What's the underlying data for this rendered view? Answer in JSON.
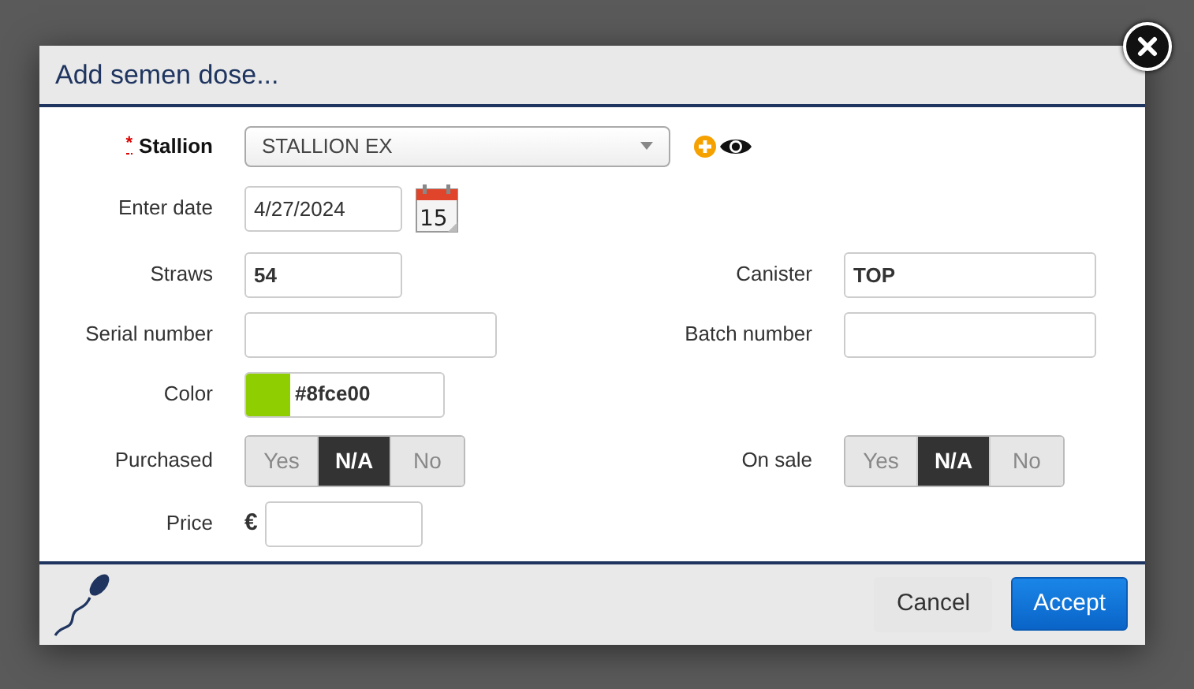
{
  "dialog": {
    "title": "Add semen dose...",
    "stallion": {
      "label": "Stallion",
      "required_mark": "*",
      "value": "STALLION EX"
    },
    "enter_date": {
      "label": "Enter date",
      "value": "4/27/2024",
      "calendar_day": "15"
    },
    "straws": {
      "label": "Straws",
      "value": "54"
    },
    "canister": {
      "label": "Canister",
      "value": "TOP"
    },
    "serial_number": {
      "label": "Serial number"
    },
    "batch_number": {
      "label": "Batch number"
    },
    "color": {
      "label": "Color",
      "value": "#8fce00"
    },
    "purchased": {
      "label": "Purchased",
      "options": [
        {
          "label": "Yes",
          "selected": false
        },
        {
          "label": "N/A",
          "selected": true
        },
        {
          "label": "No",
          "selected": false
        }
      ]
    },
    "on_sale": {
      "label": "On sale",
      "options": [
        {
          "label": "Yes",
          "selected": false
        },
        {
          "label": "N/A",
          "selected": true
        },
        {
          "label": "No",
          "selected": false
        }
      ]
    },
    "price": {
      "label": "Price",
      "currency": "€"
    },
    "buttons": [
      {
        "label": "Cancel",
        "kind": "secondary"
      },
      {
        "label": "Accept",
        "kind": "primary"
      }
    ]
  }
}
